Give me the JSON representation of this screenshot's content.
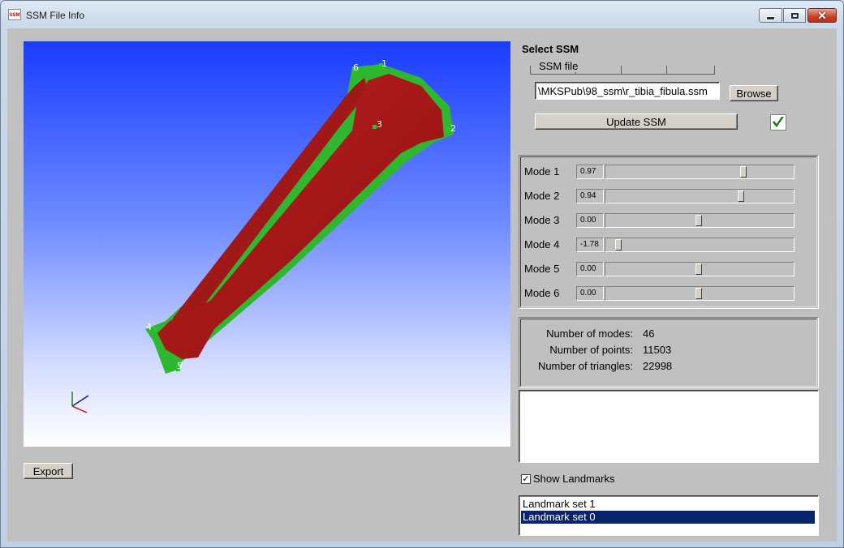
{
  "window": {
    "title": "SSM File Info",
    "app_icon_text": "SSM"
  },
  "viewport": {
    "landmarks": [
      "1",
      "2",
      "3",
      "4",
      "5",
      "6"
    ],
    "colors": {
      "bone_primary": "#b81e1e",
      "bone_secondary": "#2fb82f",
      "landmark": "#22cc22"
    }
  },
  "export_button": "Export",
  "select_ssm": {
    "title": "Select SSM",
    "file_label": "SSM file",
    "file_value": "\\MKSPub\\98_ssm\\r_tibia_fibula.ssm",
    "browse_label": "Browse",
    "update_label": "Update SSM",
    "status_icon": "check-icon"
  },
  "modes": [
    {
      "label": "Mode 1",
      "value": "0.97",
      "position": 0.74
    },
    {
      "label": "Mode 2",
      "value": "0.94",
      "position": 0.73
    },
    {
      "label": "Mode 3",
      "value": "0.00",
      "position": 0.5
    },
    {
      "label": "Mode 4",
      "value": "-1.78",
      "position": 0.05
    },
    {
      "label": "Mode 5",
      "value": "0.00",
      "position": 0.5
    },
    {
      "label": "Mode 6",
      "value": "0.00",
      "position": 0.5
    }
  ],
  "info": {
    "modes_label": "Number of modes:",
    "modes_value": "46",
    "points_label": "Number of points:",
    "points_value": "11503",
    "triangles_label": "Number of triangles:",
    "triangles_value": "22998"
  },
  "show_landmarks": {
    "label": "Show Landmarks",
    "checked": true
  },
  "landmark_sets": [
    {
      "label": "Landmark set 1",
      "selected": false
    },
    {
      "label": "Landmark set 0",
      "selected": true
    }
  ]
}
